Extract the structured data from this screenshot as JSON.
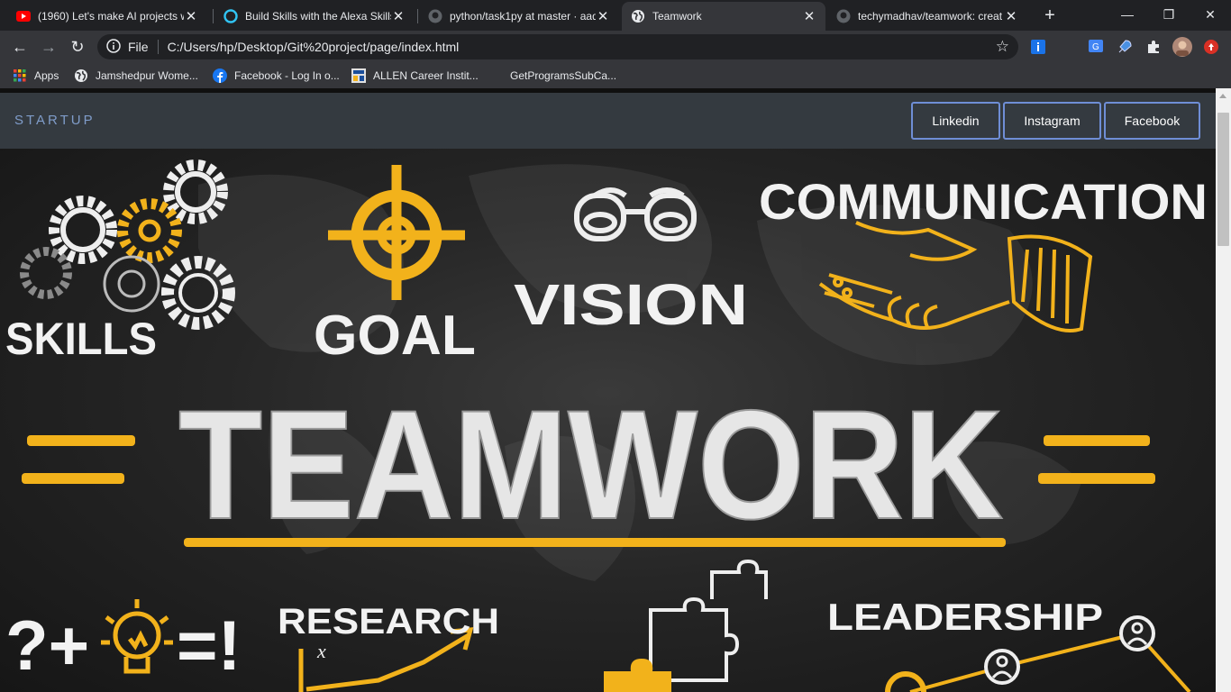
{
  "browser": {
    "tabs": [
      {
        "title": "(1960) Let's make AI projects w",
        "icon": "youtube-icon"
      },
      {
        "title": "Build Skills with the Alexa Skills",
        "icon": "alexa-icon"
      },
      {
        "title": "python/task1py at master · aad",
        "icon": "github-icon"
      },
      {
        "title": "Teamwork",
        "icon": "globe-icon"
      },
      {
        "title": "techymadhav/teamwork: creat",
        "icon": "github-icon"
      }
    ],
    "address": {
      "scheme_label": "File",
      "url": "C:/Users/hp/Desktop/Git%20project/page/index.html"
    },
    "bookmarks": [
      {
        "label": "Apps",
        "icon": "apps-grid-icon"
      },
      {
        "label": "Jamshedpur Wome...",
        "icon": "globe-icon"
      },
      {
        "label": "Facebook - Log In o...",
        "icon": "facebook-icon"
      },
      {
        "label": "ALLEN Career Instit...",
        "icon": "allen-icon"
      },
      {
        "label": "GetProgramsSubCa...",
        "icon": ""
      }
    ]
  },
  "site": {
    "brand": "STARTUP",
    "nav_buttons": [
      "Linkedin",
      "Instagram",
      "Facebook"
    ]
  },
  "hero": {
    "words": {
      "skills": "SKILLS",
      "goal": "GOAL",
      "vision": "VISION",
      "communication": "COMMUNICATION",
      "teamwork": "TEAMWORK",
      "research": "RESEARCH",
      "leadership": "LEADERSHIP",
      "idea_eq": "?+",
      "idea_result": "=!"
    },
    "colors": {
      "chalk": "#f2f2f2",
      "accent": "#f2b21b"
    }
  }
}
